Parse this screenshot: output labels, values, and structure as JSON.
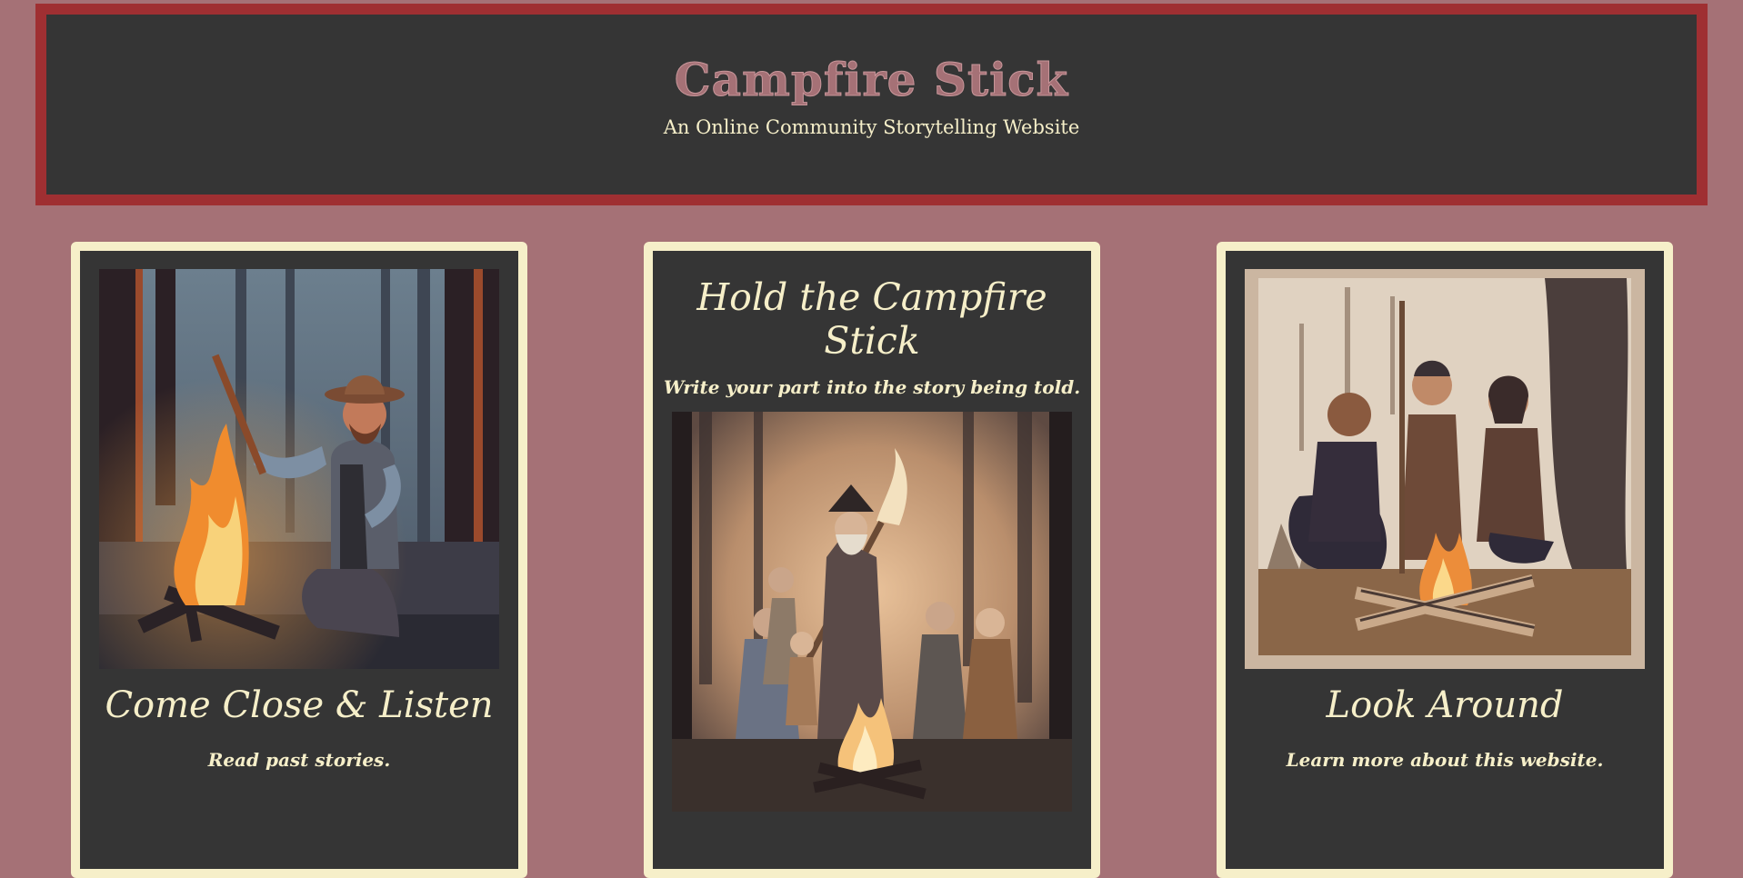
{
  "header": {
    "title": "Campfire Stick",
    "subtitle": "An Online Community Storytelling Website"
  },
  "cards": [
    {
      "heading": "Come Close & Listen",
      "description": "Read past stories."
    },
    {
      "heading": "Hold the Campfire Stick",
      "description": "Write your part into the story being told."
    },
    {
      "heading": "Look Around",
      "description": "Learn more about this website."
    }
  ],
  "colors": {
    "page_background": "#a57176",
    "header_background": "#353535",
    "header_border": "#9f2f32",
    "card_border": "#f6efc9",
    "text_cream": "#f6efc9"
  }
}
